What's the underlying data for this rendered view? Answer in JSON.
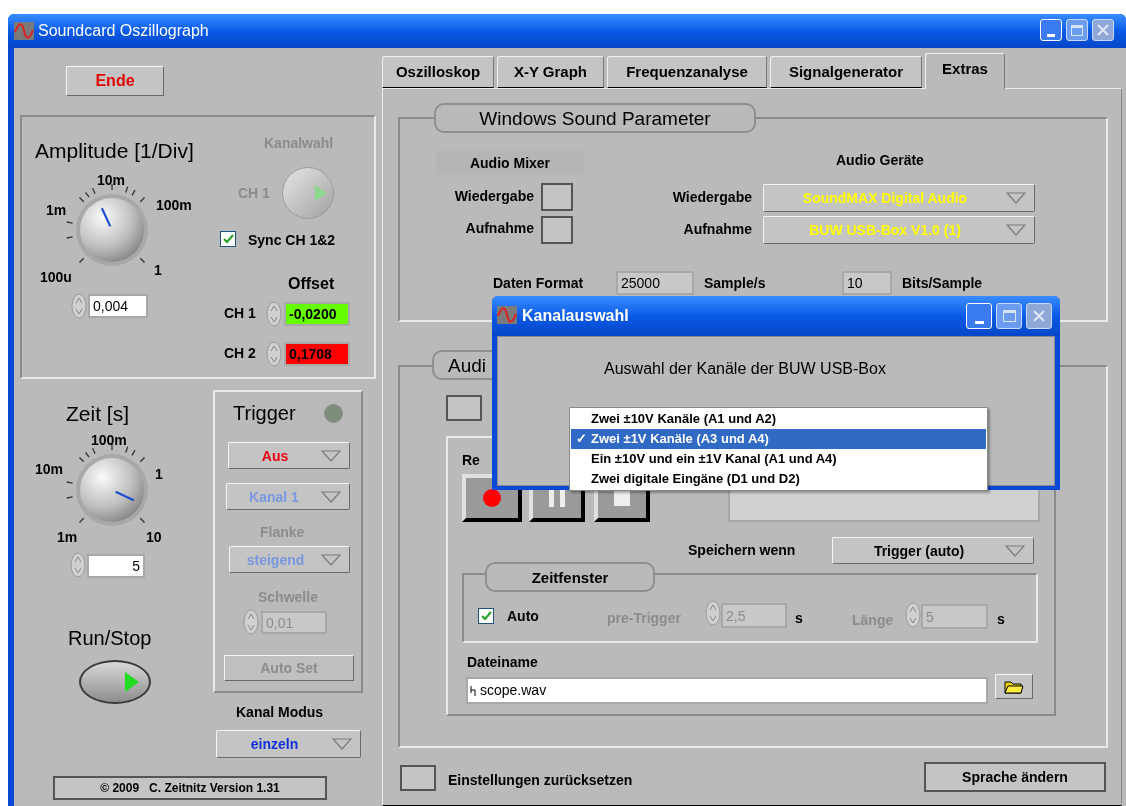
{
  "window": {
    "title": "Soundcard Oszillograph"
  },
  "exit_button": "Ende",
  "amplitude": {
    "title": "Amplitude [1/Div]",
    "scale": [
      "100u",
      "1m",
      "10m",
      "100m",
      "1"
    ],
    "value": "0,004"
  },
  "channel_select": {
    "label": "Kanalwahl",
    "channel": "CH 1",
    "disabled": true
  },
  "sync": {
    "label": "Sync CH 1&2",
    "checked": true
  },
  "offset": {
    "title": "Offset",
    "channels": [
      {
        "label": "CH 1",
        "value": "-0,0200",
        "color": "#66ff00"
      },
      {
        "label": "CH 2",
        "value": "0,1708",
        "color": "#ff0000"
      }
    ]
  },
  "time": {
    "title": "Zeit [s]",
    "scale": [
      "1m",
      "10m",
      "100m",
      "1",
      "10"
    ],
    "value": "5"
  },
  "run_stop": {
    "label": "Run/Stop"
  },
  "trigger": {
    "title": "Trigger",
    "led_on": false,
    "mode": "Aus",
    "channel": "Kanal 1",
    "edge_label": "Flanke",
    "edge": "steigend",
    "threshold_label": "Schwelle",
    "threshold": "0,01",
    "auto_set": "Auto Set",
    "disabled": true
  },
  "channel_mode": {
    "label": "Kanal Modus",
    "value": "einzeln"
  },
  "copyright_button": "© 2009   C. Zeitnitz Version 1.31",
  "tabs": [
    {
      "label": "Oszilloskop",
      "selected": false
    },
    {
      "label": "X-Y Graph",
      "selected": false
    },
    {
      "label": "Frequenzanalyse",
      "selected": false
    },
    {
      "label": "Signalgenerator",
      "selected": false
    },
    {
      "label": "Extras",
      "selected": true
    }
  ],
  "sound_params": {
    "title": "Windows Sound Parameter",
    "mixer": {
      "title": "Audio Mixer",
      "rows": [
        {
          "label": "Wiedergabe"
        },
        {
          "label": "Aufnahme"
        }
      ]
    },
    "devices": {
      "title": "Audio Geräte",
      "rows": [
        {
          "label": "Wiedergabe",
          "value": "SoundMAX Digital Audio"
        },
        {
          "label": "Aufnahme",
          "value": "BUW USB-Box V1.0 (1)"
        }
      ]
    },
    "format": {
      "label": "Daten Format",
      "rate": "25000",
      "rate_unit": "Sample/s",
      "bits": "10",
      "bits_unit": "Bits/Sample"
    }
  },
  "audio_group": {
    "title": "Audi",
    "record_label": "Re",
    "save_when_label": "Speichern wenn",
    "save_when": "Trigger (auto)",
    "time_window": {
      "title": "Zeitfenster",
      "auto_label": "Auto",
      "auto": true,
      "pretrigger_label": "pre-Trigger",
      "pretrigger": "2,5",
      "pretrigger_unit": "s",
      "length_label": "Länge",
      "length": "5",
      "length_unit": "s"
    },
    "file_label": "Dateiname",
    "file": "scope.wav"
  },
  "reset": {
    "label": "Einstellungen zurücksetzen"
  },
  "language_button": "Sprache ändern",
  "dialog": {
    "title": "Kanalauswahl",
    "message": "Auswahl der Kanäle der BUW USB-Box",
    "check_mark": "✓",
    "options": [
      {
        "label": "Zwei ±10V Kanäle (A1 und A2)",
        "selected": false
      },
      {
        "label": "Zwei ±1V Kanäle (A3 und A4)",
        "selected": true
      },
      {
        "label": "Ein ±10V und ein ±1V Kanal (A1 und A4)",
        "selected": false
      },
      {
        "label": "Zwei digitale Eingäne (D1 und D2)",
        "selected": false
      }
    ]
  }
}
